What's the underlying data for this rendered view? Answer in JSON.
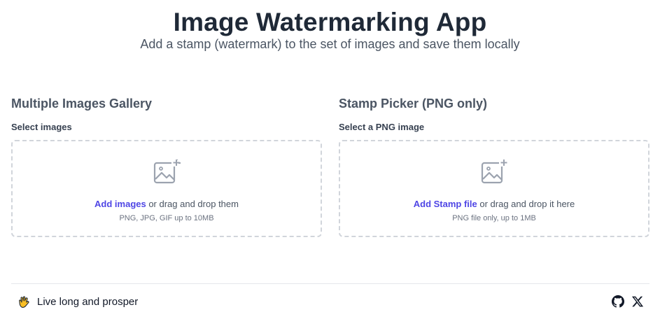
{
  "header": {
    "title": "Image Watermarking App",
    "subtitle": "Add a stamp (watermark) to the set of images and save them locally"
  },
  "gallery": {
    "heading": "Multiple Images Gallery",
    "field_label": "Select images",
    "link_text": "Add images",
    "rest_text": " or drag and drop them",
    "hint": "PNG, JPG, GIF up to 10MB",
    "icon": "image-add-icon"
  },
  "stamp": {
    "heading": "Stamp Picker (PNG only)",
    "field_label": "Select a PNG image",
    "link_text": "Add Stamp file",
    "rest_text": " or drag and drop it here",
    "hint": "PNG file only, up to 1MB",
    "icon": "image-add-icon"
  },
  "footer": {
    "text": "Live long and prosper",
    "icons": [
      "vulcan-salute-icon",
      "github-icon",
      "x-icon"
    ]
  },
  "colors": {
    "accent": "#4f46e5",
    "title": "#1f2937",
    "muted": "#4b5563",
    "border": "#d1d5db"
  }
}
